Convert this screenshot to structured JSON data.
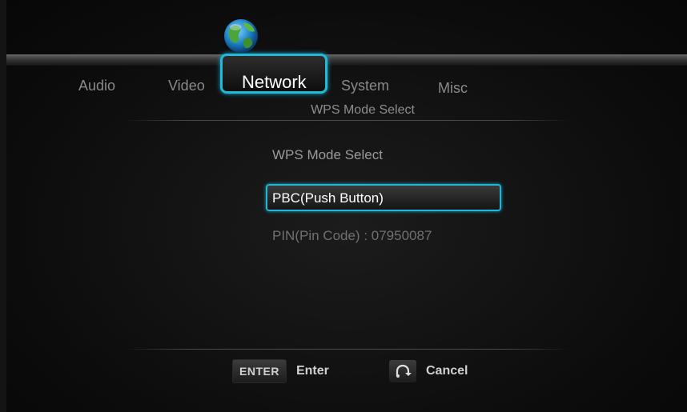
{
  "tabs": {
    "audio": "Audio",
    "video": "Video",
    "network": "Network",
    "system": "System",
    "misc": "Misc"
  },
  "active_tab_icon": "globe-icon",
  "page_subtitle": "WPS Mode Select",
  "section_heading": "WPS Mode Select",
  "options": [
    {
      "label": "PBC(Push Button)",
      "selected": true
    },
    {
      "label": "PIN(Pin Code) : 07950087",
      "selected": false
    }
  ],
  "hints": {
    "enter_key": "ENTER",
    "enter_label": "Enter",
    "cancel_icon": "return-arrow-icon",
    "cancel_label": "Cancel"
  },
  "colors": {
    "accent": "#23b8d8",
    "background": "#0c0c0c"
  }
}
